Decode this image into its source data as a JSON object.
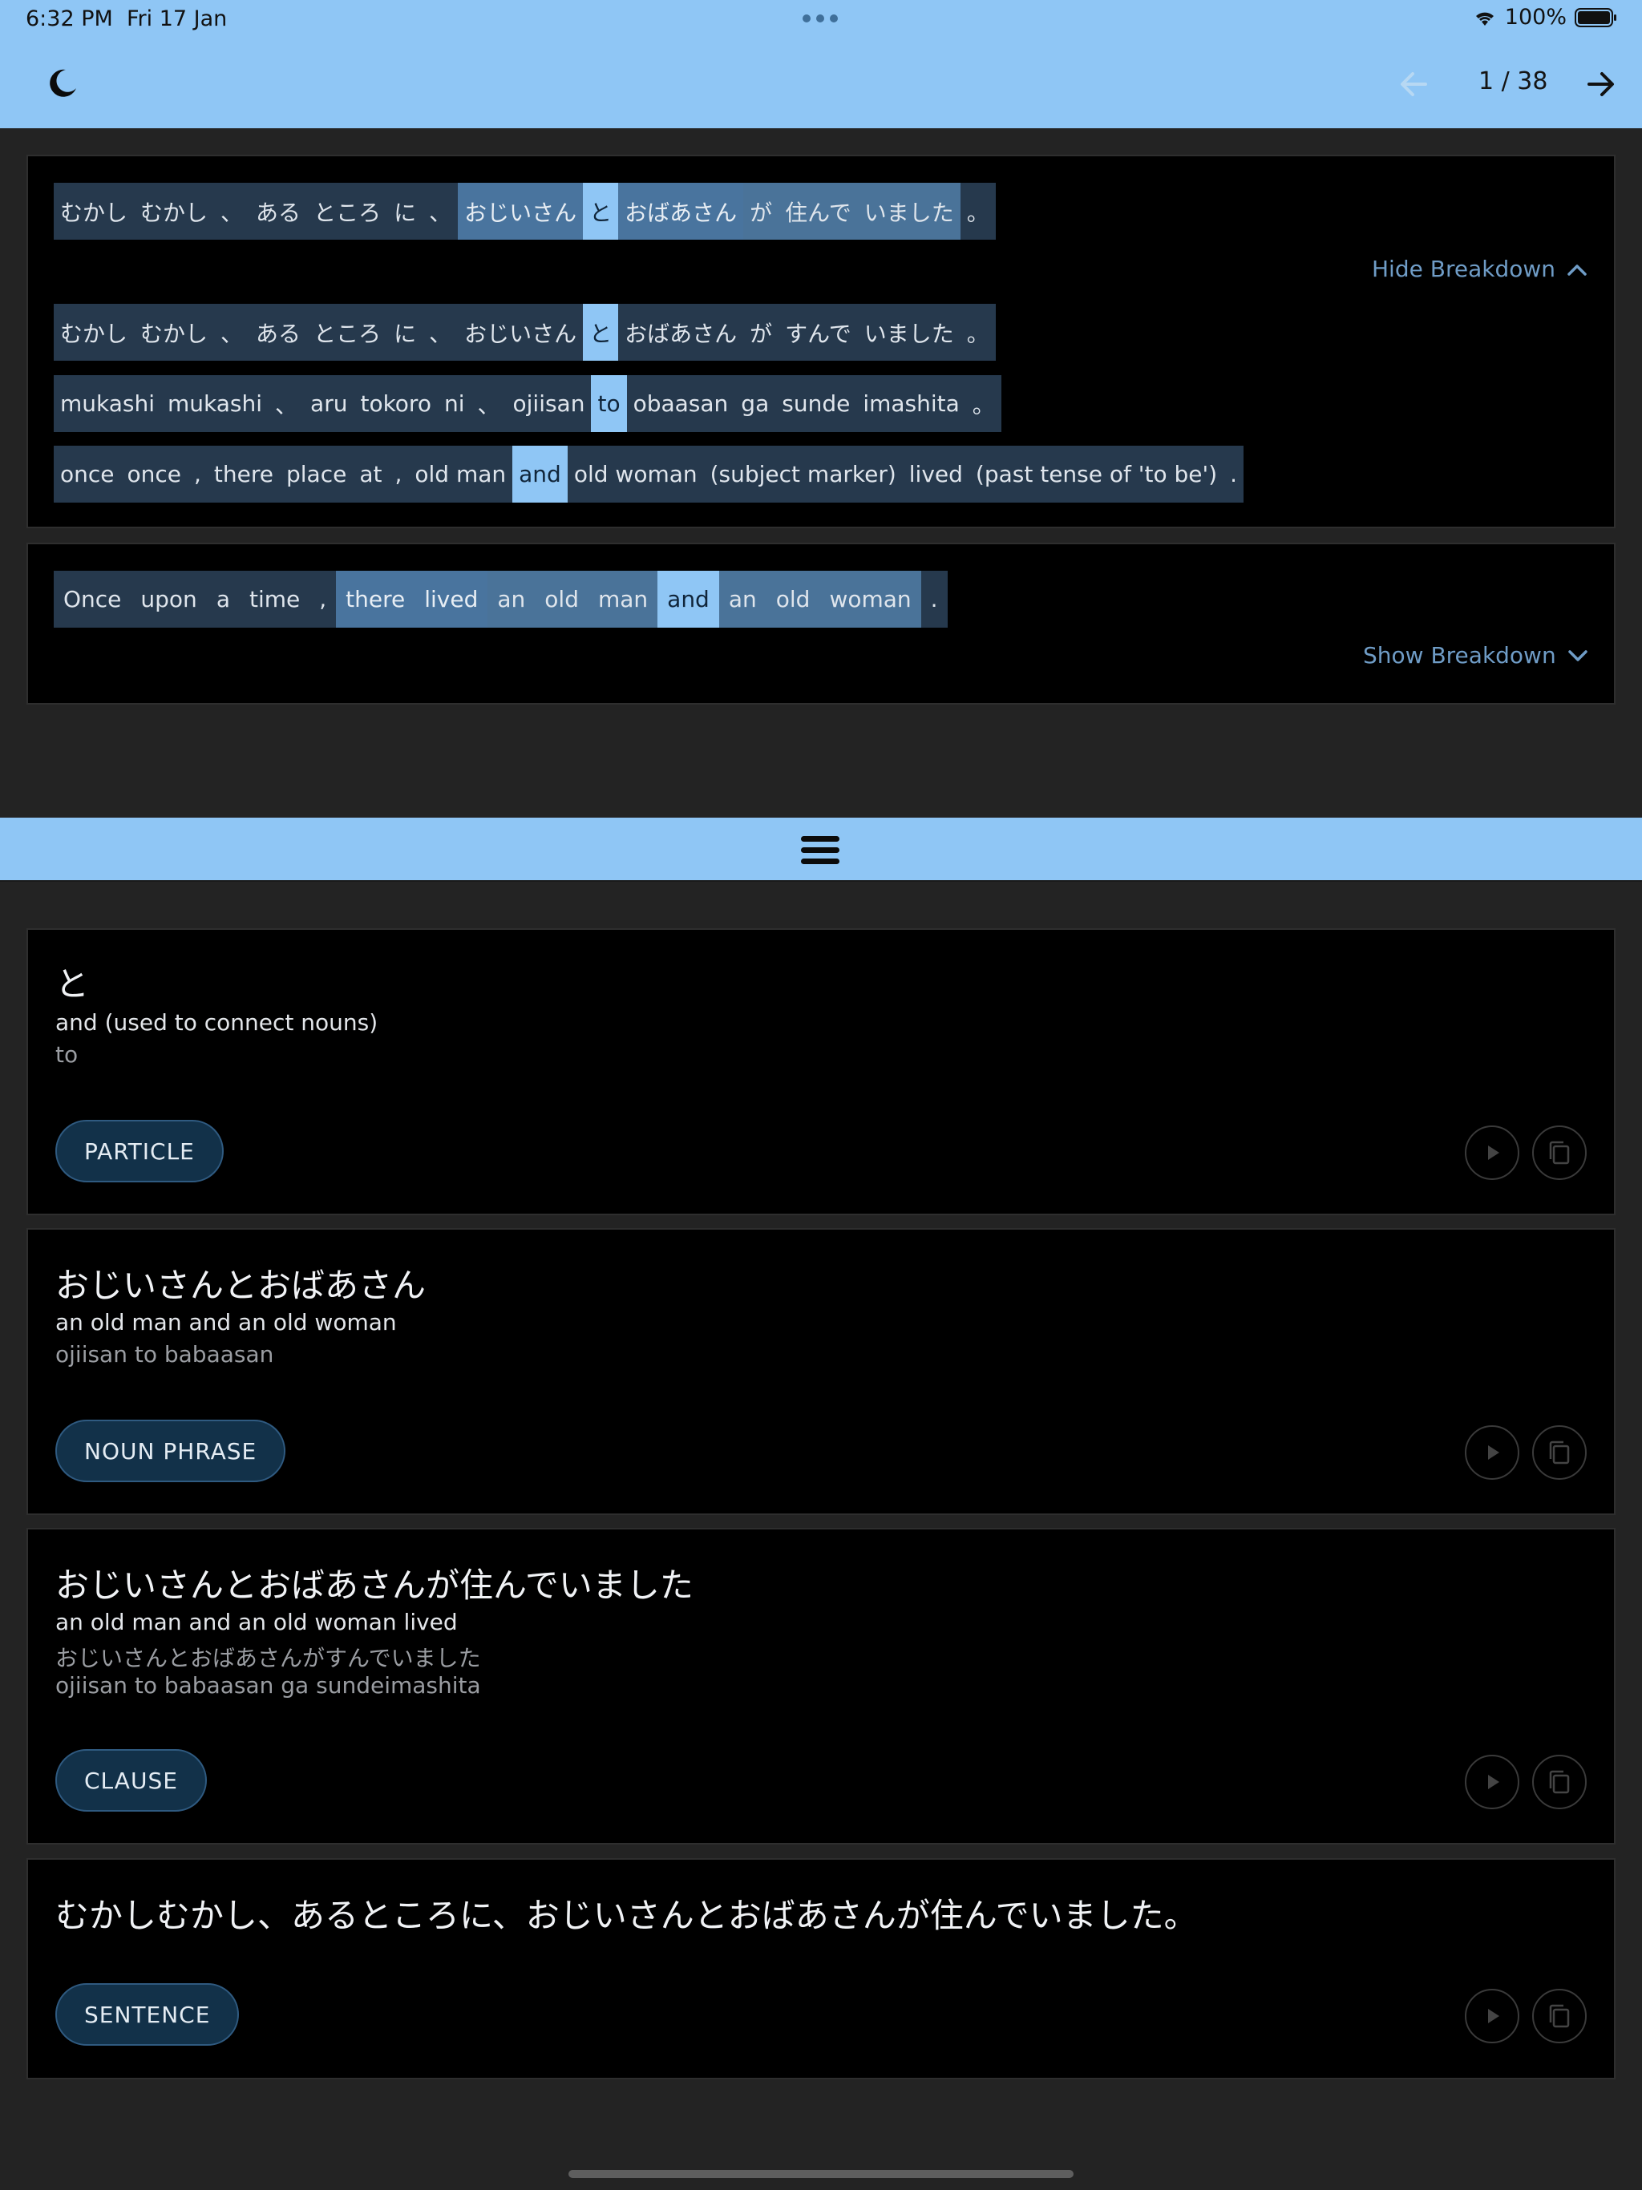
{
  "status": {
    "time": "6:32 PM",
    "date": "Fri 17 Jan",
    "battery": "100%"
  },
  "header": {
    "page_indicator": "1 / 38"
  },
  "source": {
    "tokens": [
      {
        "text": "むかし",
        "lvl": ""
      },
      {
        "text": "むかし",
        "lvl": ""
      },
      {
        "text": "、",
        "lvl": ""
      },
      {
        "text": "ある",
        "lvl": ""
      },
      {
        "text": "ところ",
        "lvl": ""
      },
      {
        "text": "に",
        "lvl": ""
      },
      {
        "text": "、",
        "lvl": ""
      },
      {
        "text": "おじいさん",
        "lvl": "l1"
      },
      {
        "text": "と",
        "lvl": "hi"
      },
      {
        "text": "おばあさん",
        "lvl": "l1"
      },
      {
        "text": "が",
        "lvl": "l2"
      },
      {
        "text": "住んで",
        "lvl": "l2"
      },
      {
        "text": "いました",
        "lvl": "l2"
      },
      {
        "text": "。",
        "lvl": ""
      }
    ],
    "breakdown_toggle": "Hide Breakdown"
  },
  "breakdown": {
    "kana": [
      {
        "text": "むかし",
        "lvl": ""
      },
      {
        "text": "むかし",
        "lvl": ""
      },
      {
        "text": "、",
        "lvl": ""
      },
      {
        "text": "ある",
        "lvl": ""
      },
      {
        "text": "ところ",
        "lvl": ""
      },
      {
        "text": "に",
        "lvl": ""
      },
      {
        "text": "、",
        "lvl": ""
      },
      {
        "text": "おじいさん",
        "lvl": ""
      },
      {
        "text": "と",
        "lvl": "hi"
      },
      {
        "text": "おばあさん",
        "lvl": ""
      },
      {
        "text": "が",
        "lvl": ""
      },
      {
        "text": "すんで",
        "lvl": ""
      },
      {
        "text": "いました",
        "lvl": ""
      },
      {
        "text": "。",
        "lvl": ""
      }
    ],
    "romaji": [
      {
        "text": "mukashi",
        "lvl": ""
      },
      {
        "text": "mukashi",
        "lvl": ""
      },
      {
        "text": "、",
        "lvl": ""
      },
      {
        "text": "aru",
        "lvl": ""
      },
      {
        "text": "tokoro",
        "lvl": ""
      },
      {
        "text": "ni",
        "lvl": ""
      },
      {
        "text": "、",
        "lvl": ""
      },
      {
        "text": "ojiisan",
        "lvl": ""
      },
      {
        "text": "to",
        "lvl": "hi"
      },
      {
        "text": "obaasan",
        "lvl": ""
      },
      {
        "text": "ga",
        "lvl": ""
      },
      {
        "text": "sunde",
        "lvl": ""
      },
      {
        "text": "imashita",
        "lvl": ""
      },
      {
        "text": "。",
        "lvl": ""
      }
    ],
    "gloss": [
      {
        "text": "once",
        "lvl": ""
      },
      {
        "text": "once",
        "lvl": ""
      },
      {
        "text": ",",
        "lvl": ""
      },
      {
        "text": "there",
        "lvl": ""
      },
      {
        "text": "place",
        "lvl": ""
      },
      {
        "text": "at",
        "lvl": ""
      },
      {
        "text": ",",
        "lvl": ""
      },
      {
        "text": "old man",
        "lvl": ""
      },
      {
        "text": "and",
        "lvl": "hi"
      },
      {
        "text": "old woman",
        "lvl": ""
      },
      {
        "text": "(subject marker)",
        "lvl": ""
      },
      {
        "text": "lived",
        "lvl": ""
      },
      {
        "text": "(past tense of 'to be')",
        "lvl": ""
      },
      {
        "text": ".",
        "lvl": ""
      }
    ]
  },
  "translation": {
    "tokens": [
      {
        "text": "Once",
        "lvl": ""
      },
      {
        "text": "upon",
        "lvl": ""
      },
      {
        "text": "a",
        "lvl": ""
      },
      {
        "text": "time",
        "lvl": ""
      },
      {
        "text": ",",
        "lvl": ""
      },
      {
        "text": "there",
        "lvl": "l1"
      },
      {
        "text": "lived",
        "lvl": "l1"
      },
      {
        "text": "an",
        "lvl": "l2"
      },
      {
        "text": "old",
        "lvl": "l2"
      },
      {
        "text": "man",
        "lvl": "l2"
      },
      {
        "text": "and",
        "lvl": "hi"
      },
      {
        "text": "an",
        "lvl": "l2"
      },
      {
        "text": "old",
        "lvl": "l2"
      },
      {
        "text": "woman",
        "lvl": "l2"
      },
      {
        "text": ".",
        "lvl": ""
      }
    ],
    "breakdown_toggle": "Show Breakdown"
  },
  "cards": [
    {
      "title": "と",
      "meaning": "and (used to connect nouns)",
      "subs": [
        "to"
      ],
      "tag": "PARTICLE"
    },
    {
      "title": "おじいさんとおばあさん",
      "meaning": "an old man and an old woman",
      "subs": [
        "ojiisan to babaasan"
      ],
      "tag": "NOUN PHRASE"
    },
    {
      "title": "おじいさんとおばあさんが住んでいました",
      "meaning": "an old man and an old woman lived",
      "subs": [
        "おじいさんとおばあさんがすんでいました",
        "ojiisan to babaasan ga sundeimashita"
      ],
      "tag": "CLAUSE"
    },
    {
      "title": "むかしむかし、あるところに、おじいさんとおばあさんが住んでいました。",
      "meaning": "",
      "subs": [],
      "tag": "SENTENCE"
    }
  ],
  "icons": {
    "theme": "moon-icon",
    "prev": "arrow-left-icon",
    "next": "arrow-right-icon",
    "drawer": "hamburger-icon",
    "play": "play-icon",
    "copy": "copy-icon"
  },
  "colors": {
    "accent": "#8fc6f5",
    "token_base": "#26394d",
    "token_group": "#49749e",
    "token_highlight": "#8fc6f5",
    "tag_bg": "#123149"
  }
}
